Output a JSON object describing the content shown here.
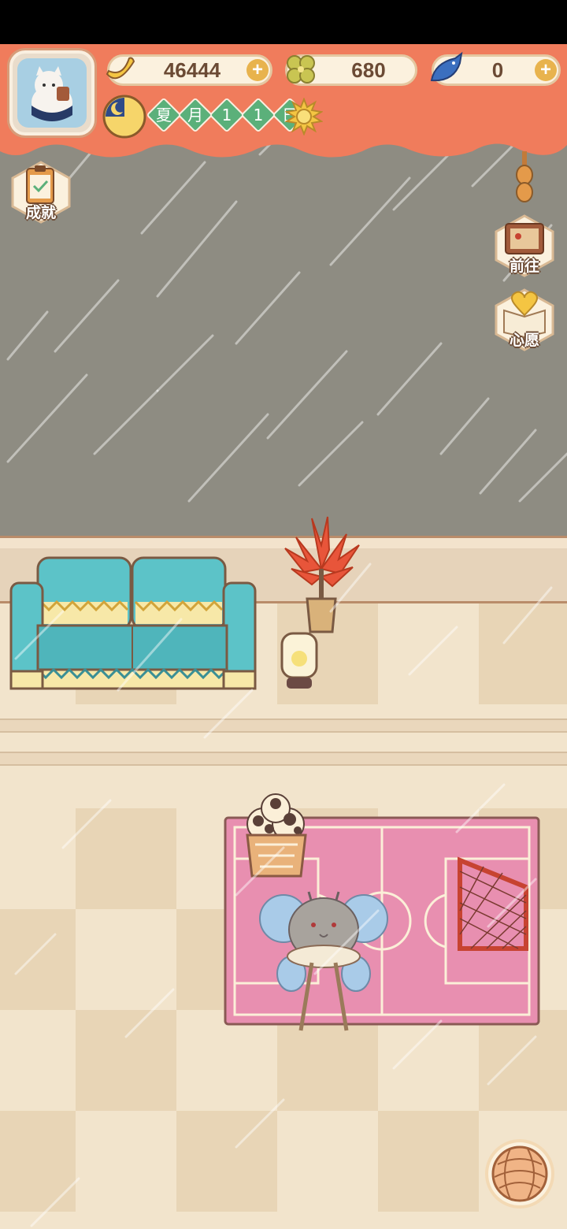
{
  "currencies": {
    "banana": {
      "value": "46444",
      "icon": "banana-icon"
    },
    "clover": {
      "value": "680",
      "icon": "clover-icon"
    },
    "fish": {
      "value": "0",
      "icon": "fish-icon"
    }
  },
  "date": {
    "chars": [
      "夏",
      "月",
      "1",
      "1",
      "日"
    ]
  },
  "side_buttons": {
    "achievement": "成就",
    "goto": "前往",
    "wish": "心愿"
  },
  "colors": {
    "banner": "#f07c5c",
    "sky": "#8e8c82",
    "sofa": "#5cc3c8",
    "rug": "#e88fb0"
  }
}
